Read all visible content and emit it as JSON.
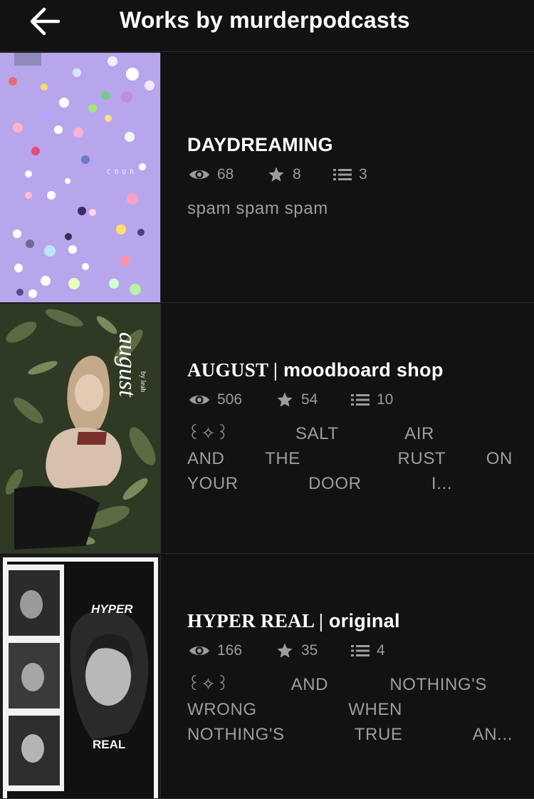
{
  "header": {
    "title": "Works by murderpodcasts"
  },
  "works": [
    {
      "title": "DAYDREAMING",
      "views": "68",
      "votes": "8",
      "parts": "3",
      "description": "spam spam spam"
    },
    {
      "title_serif": "AUGUST |",
      "title_rest": " moodboard shop",
      "views": "506",
      "votes": "54",
      "parts": "10",
      "desc_lines": [
        [
          "꒰✧꒱",
          "SALT",
          "AIR"
        ],
        [
          "AND",
          "THE",
          "RUST",
          "ON"
        ],
        [
          "YOUR",
          "DOOR",
          "I..."
        ]
      ]
    },
    {
      "title_serif": "HYPER REAL |",
      "title_rest": " original",
      "views": "166",
      "votes": "35",
      "parts": "4",
      "desc_lines": [
        [
          "꒰✧꒱",
          "AND",
          "NOTHING'S"
        ],
        [
          "WRONG",
          "WHEN"
        ],
        [
          "NOTHING'S",
          "TRUE",
          "AN..."
        ]
      ]
    }
  ],
  "covers": {
    "daydreaming_text": "C O U R",
    "august_text": "august",
    "august_by": "by leah",
    "hyper_top": "HYPER",
    "hyper_bottom": "REAL"
  }
}
